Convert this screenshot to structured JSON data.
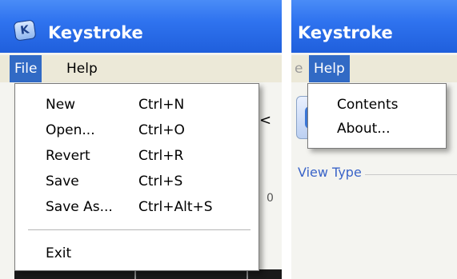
{
  "left_window": {
    "title": "Keystroke",
    "menubar": {
      "file_label": "File",
      "help_label": "Help"
    },
    "file_menu": {
      "items": [
        {
          "label": "New",
          "shortcut": "Ctrl+N"
        },
        {
          "label": "Open...",
          "shortcut": "Ctrl+O"
        },
        {
          "label": "Revert",
          "shortcut": "Ctrl+R"
        },
        {
          "label": "Save",
          "shortcut": "Ctrl+S"
        },
        {
          "label": "Save As...",
          "shortcut": "Ctrl+Alt+S"
        },
        {
          "label": "Exit",
          "shortcut": ""
        }
      ]
    }
  },
  "right_window": {
    "title": "Keystroke",
    "menubar": {
      "partial_label": "e",
      "help_label": "Help"
    },
    "help_menu": {
      "items": [
        {
          "label": "Contents"
        },
        {
          "label": "About..."
        }
      ]
    },
    "view_type_label": "View Type"
  },
  "colors": {
    "titlebar": "#2f73ef",
    "menu_highlight": "#316ac5",
    "link_blue": "#3a64c8"
  },
  "icons": {
    "app_icon": "keystroke-app-icon"
  }
}
